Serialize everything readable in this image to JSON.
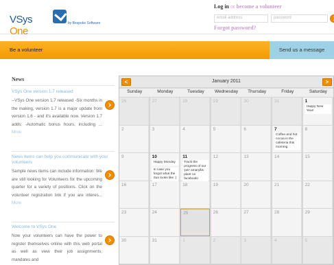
{
  "header": {
    "logo_main": "VSys",
    "logo_accent": "One",
    "logo_tagline": "by Bespoke Software",
    "login_text": "Log in",
    "login_or": "or",
    "volunteer_link": "become a volunteer",
    "email_placeholder": "email address",
    "password_placeholder": "password",
    "forgot_password": "Forgot password?"
  },
  "navbar": {
    "be_volunteer": "Be a volunteer",
    "send_message": "Send us a message"
  },
  "news": {
    "title": "News",
    "items": [
      {
        "title": "VSys One version 1.7 released",
        "body": "--VSys One version 1.7 released -Six months in the making, version 1.7 is a major update from version 1.6 - and it's available now. Version 1.7 adds: -Automatic bonus hours, including ...",
        "more": "More"
      },
      {
        "title": "News items can help you communicate with your volunteers",
        "body": "Sample news items can include information: We are still looking for Volunteers for the upcoming quarter for a variety of positions. Click on the volunteer registration link if you are interes...",
        "more": "More"
      },
      {
        "title": "Welcome to VSys One",
        "body": "Now your volunteers can have the power to register themselves online with this web portal as well as view their job assignments, mandates and",
        "more": ""
      }
    ]
  },
  "calendar": {
    "title": "January 2011",
    "prev_label": "<",
    "next_label": ">",
    "days_of_week": [
      "Sunday",
      "Monday",
      "Tuesday",
      "Wednesday",
      "Thursday",
      "Friday",
      "Saturday"
    ],
    "weeks": [
      [
        {
          "day": "26",
          "faded": true
        },
        {
          "day": "27",
          "faded": true
        },
        {
          "day": "28",
          "faded": true
        },
        {
          "day": "29",
          "faded": true
        },
        {
          "day": "30",
          "faded": true
        },
        {
          "day": "31",
          "faded": true
        },
        {
          "day": "1",
          "strong": true,
          "events": [
            "Happy New Year!"
          ]
        }
      ],
      [
        {
          "day": "2"
        },
        {
          "day": "3"
        },
        {
          "day": "4"
        },
        {
          "day": "5"
        },
        {
          "day": "6"
        },
        {
          "day": "7",
          "strong": true,
          "events": [
            "Coffee and hot cocoa in the cafeteria this morning."
          ]
        },
        {
          "day": "8"
        }
      ],
      [
        {
          "day": "9"
        },
        {
          "day": "10",
          "strong": true,
          "events": [
            "Happy Monday",
            "In case you forgot what the Sun looks like :)",
            "Free Lunch in the Lobby today :)"
          ]
        },
        {
          "day": "11",
          "strong": true,
          "events": [
            "Track the progress of our 'pet' amaryllis plant on facebook!"
          ]
        },
        {
          "day": "12"
        },
        {
          "day": "13"
        },
        {
          "day": "14"
        },
        {
          "day": "15"
        }
      ],
      [
        {
          "day": "16"
        },
        {
          "day": "17"
        },
        {
          "day": "18"
        },
        {
          "day": "19"
        },
        {
          "day": "20"
        },
        {
          "day": "21"
        },
        {
          "day": "22"
        }
      ],
      [
        {
          "day": "23"
        },
        {
          "day": "24"
        },
        {
          "day": "25",
          "today": true
        },
        {
          "day": "26"
        },
        {
          "day": "27"
        },
        {
          "day": "28"
        },
        {
          "day": "29"
        }
      ],
      [
        {
          "day": "30"
        },
        {
          "day": "31"
        },
        {
          "day": "1",
          "faded": true
        },
        {
          "day": "2",
          "faded": true
        },
        {
          "day": "3",
          "faded": true
        },
        {
          "day": "4",
          "faded": true
        },
        {
          "day": "5",
          "faded": true
        }
      ]
    ]
  },
  "colors": {
    "accent_orange": "#f28c00",
    "link_purple": "#c79bd3",
    "news_title_blue": "#89b6d9",
    "message_tab_blue": "#9fd1e6"
  }
}
